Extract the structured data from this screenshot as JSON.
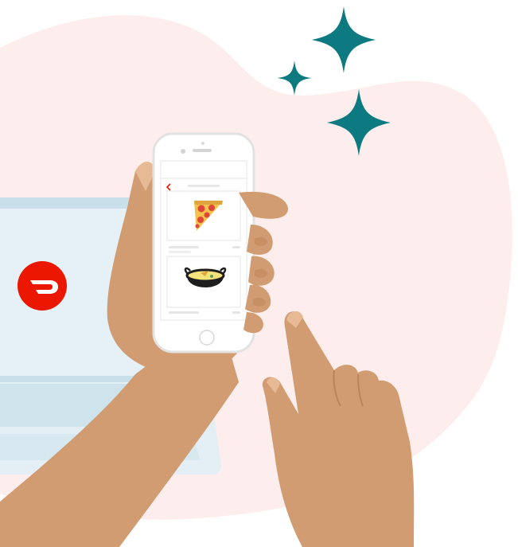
{
  "illustration": {
    "brand_logo_icon": "doordash-logo-icon",
    "phone_screen": {
      "back_icon": "chevron-left-icon",
      "items": [
        {
          "icon": "pizza-slice-icon"
        },
        {
          "icon": "curry-bowl-icon"
        }
      ]
    },
    "decorations": [
      "sparkle-icon",
      "sparkle-icon",
      "sparkle-icon"
    ]
  },
  "colors": {
    "background_blob": "#FDEDED",
    "laptop_screen": "#E5F1F6",
    "laptop_frame": "#C9E0EB",
    "brand_red": "#EB1700",
    "sparkle_teal": "#0C7A80",
    "skin": "#D19C72",
    "skin_shadow": "#BB8459",
    "phone_body": "#FFFFFF",
    "phone_outline": "#E2E2E2"
  }
}
